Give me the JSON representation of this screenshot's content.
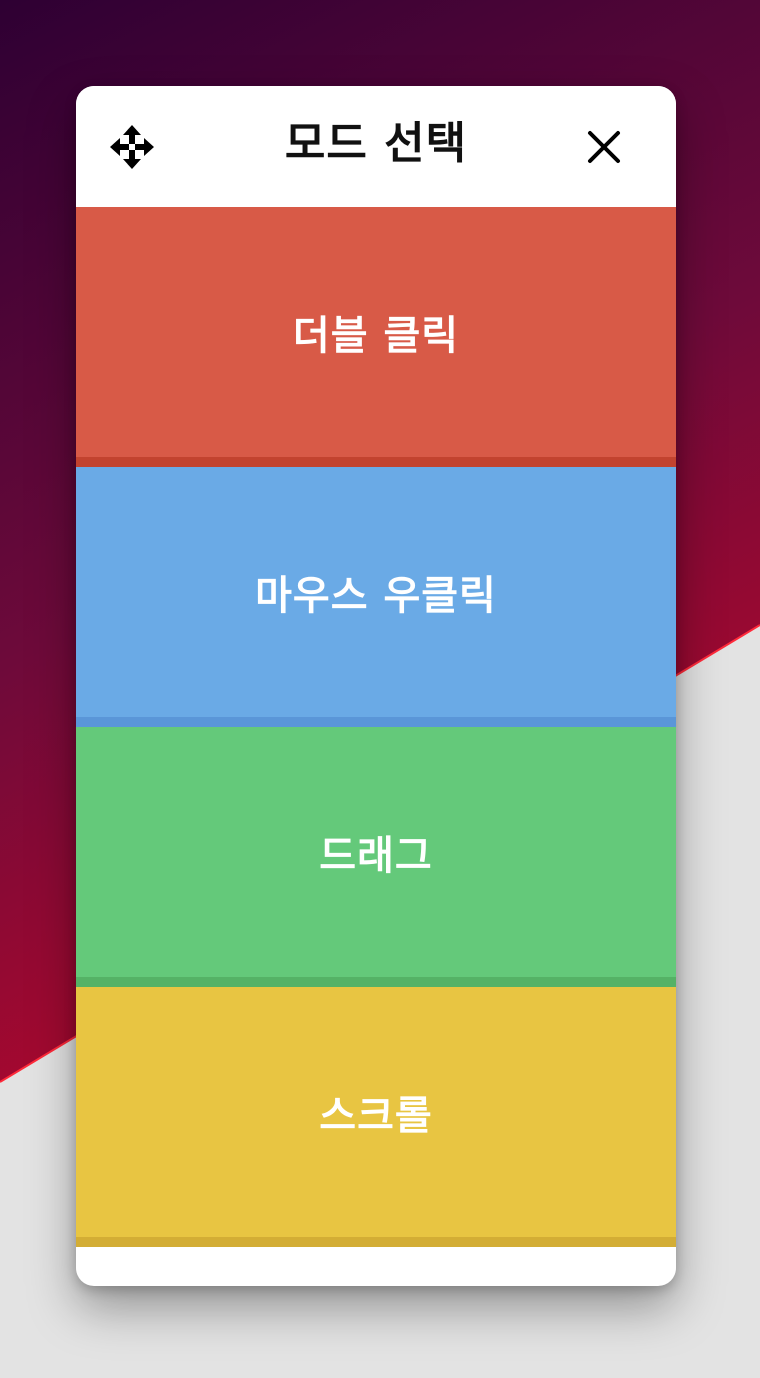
{
  "panel": {
    "title": "모드 선택",
    "move_icon": "move-arrows-icon",
    "close_icon": "close-icon"
  },
  "modes": [
    {
      "label": "더블 클릭",
      "color": "#d85a47",
      "edge_color": "#c2432f"
    },
    {
      "label": "마우스 우클릭",
      "color": "#6aaae6",
      "edge_color": "#5a96d8"
    },
    {
      "label": "드래그",
      "color": "#64c97a",
      "edge_color": "#55b266"
    },
    {
      "label": "스크롤",
      "color": "#e8c542",
      "edge_color": "#d3ad35"
    }
  ],
  "theme": {
    "wallpaper_top": "#2e0033",
    "wallpaper_bottom": "#b3082c",
    "wallpaper_light": "#e3e3e3"
  }
}
